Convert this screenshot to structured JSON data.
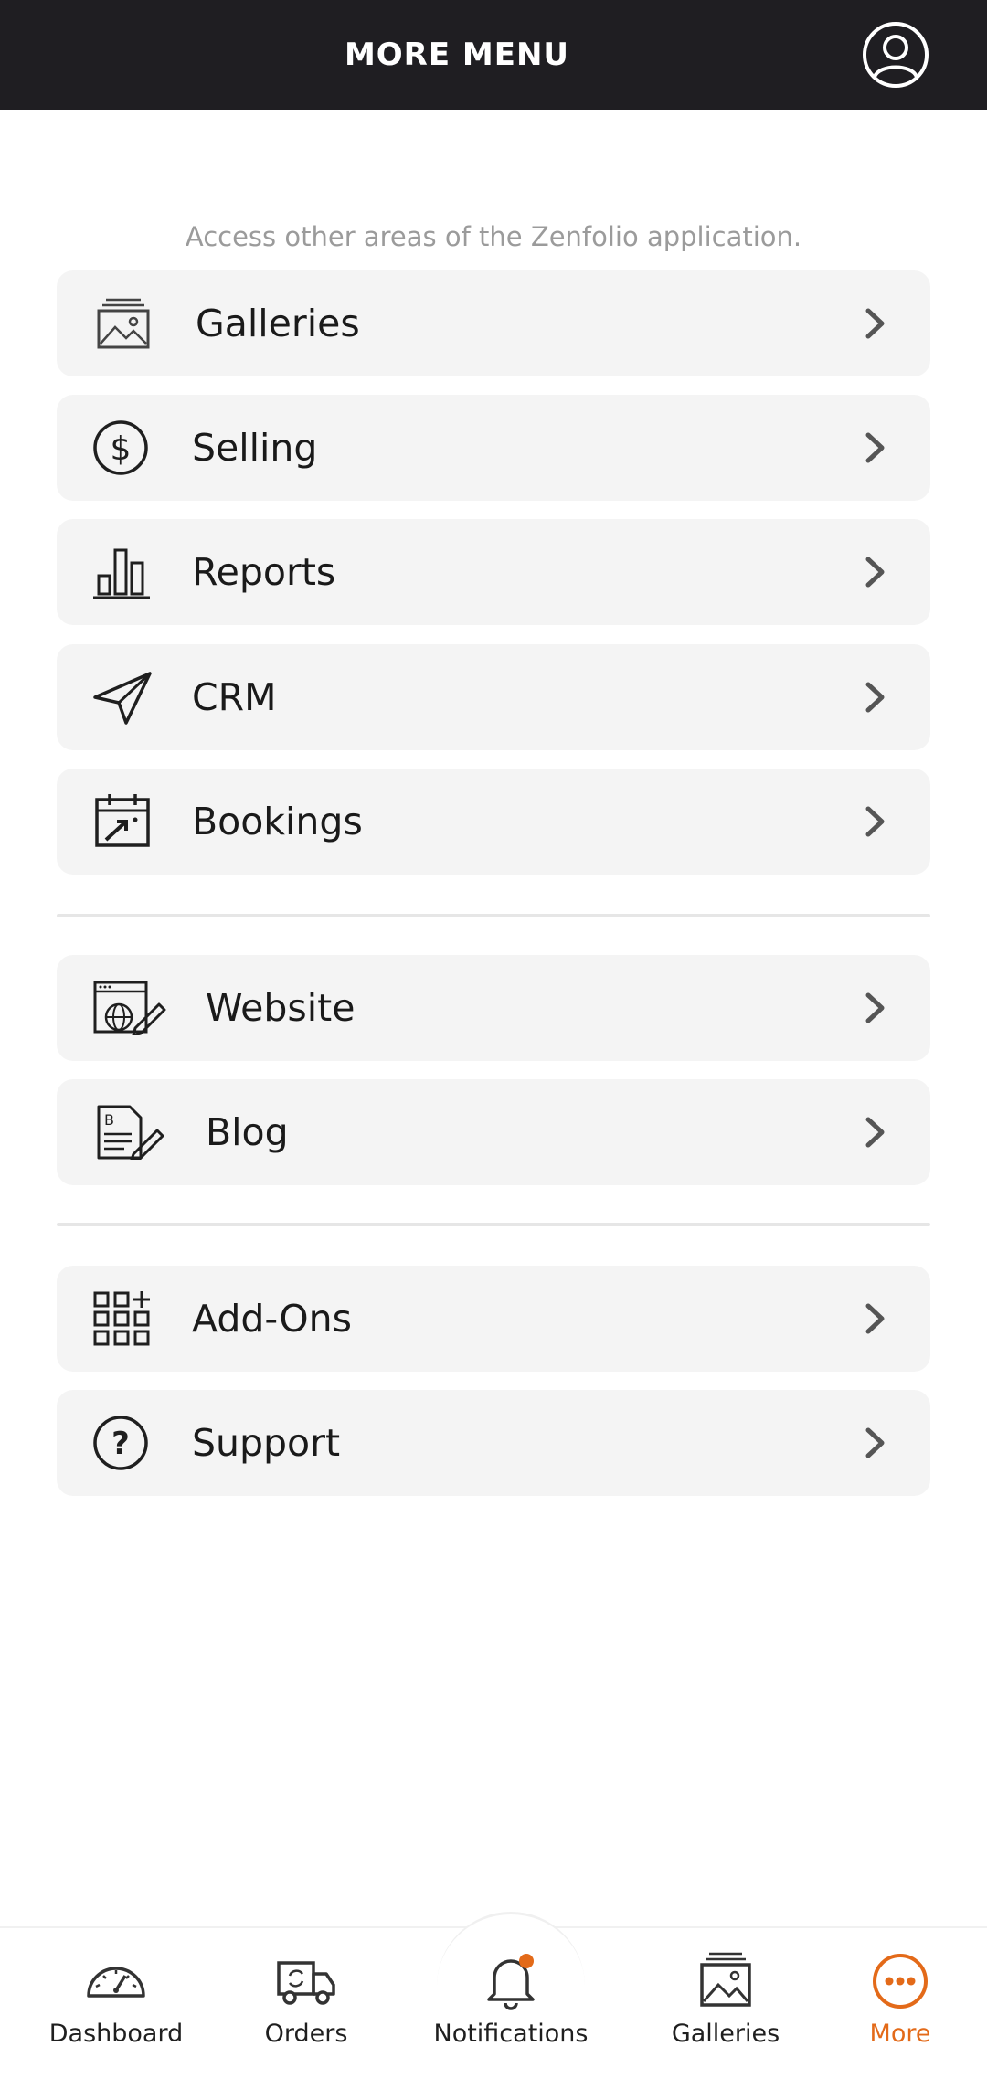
{
  "header": {
    "title": "MORE MENU",
    "profile_icon": "user-circle-icon"
  },
  "subtitle": "Access other areas of the Zenfolio application.",
  "menu": [
    {
      "label": "Galleries",
      "icon": "galleries-icon"
    },
    {
      "label": "Selling",
      "icon": "dollar-circle-icon"
    },
    {
      "label": "Reports",
      "icon": "bar-chart-icon"
    },
    {
      "label": "CRM",
      "icon": "paper-plane-icon"
    },
    {
      "label": "Bookings",
      "icon": "calendar-icon"
    },
    {
      "label": "Website",
      "icon": "website-edit-icon"
    },
    {
      "label": "Blog",
      "icon": "blog-edit-icon"
    },
    {
      "label": "Add-Ons",
      "icon": "grid-plus-icon"
    },
    {
      "label": "Support",
      "icon": "question-circle-icon"
    }
  ],
  "bottom_nav": [
    {
      "label": "Dashboard",
      "icon": "speedometer-icon"
    },
    {
      "label": "Orders",
      "icon": "truck-icon"
    },
    {
      "label": "Notifications",
      "icon": "bell-icon"
    },
    {
      "label": "Galleries",
      "icon": "galleries-icon"
    },
    {
      "label": "More",
      "icon": "more-dots-icon",
      "active": true
    }
  ],
  "colors": {
    "header_bg": "#1f1e22",
    "accent": "#e36a19",
    "item_bg": "#f4f4f4",
    "subtitle": "#9b9b9b"
  }
}
